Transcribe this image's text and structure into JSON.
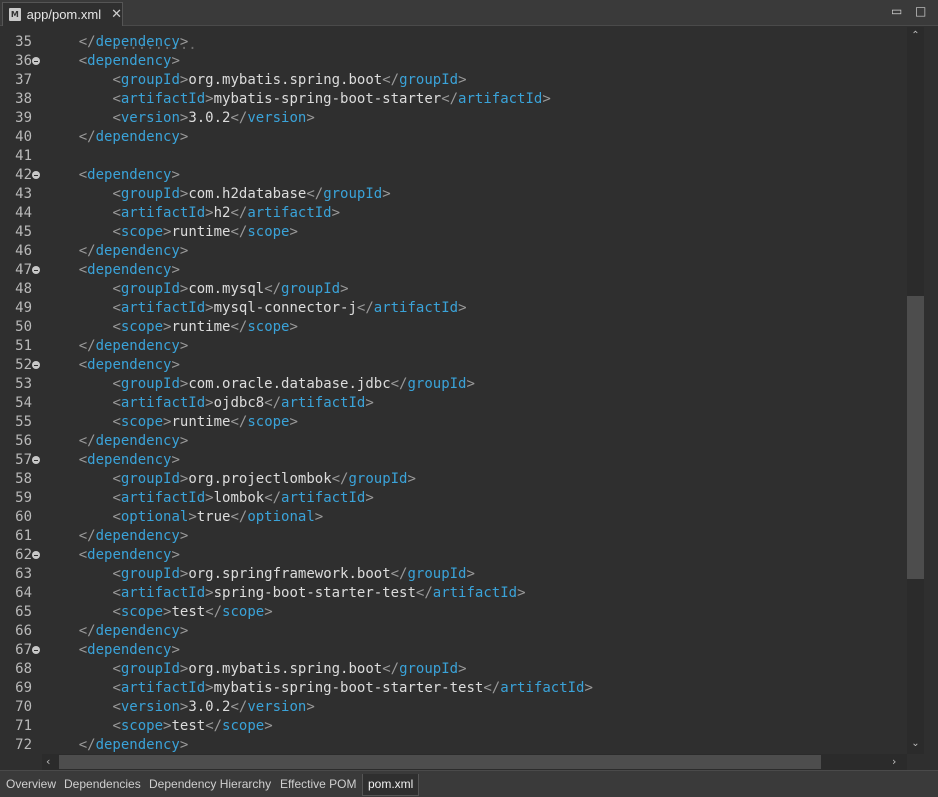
{
  "editor_tab": {
    "title": "app/pom.xml",
    "icon": "xml-file-icon"
  },
  "window_controls": {
    "minimize": "▭",
    "maximize": "□"
  },
  "code_lines": [
    {
      "n": "35",
      "fold": false,
      "indent": 4,
      "parts": [
        [
          "b",
          "</"
        ],
        [
          "t",
          "dependency"
        ],
        [
          "b",
          ">"
        ]
      ]
    },
    {
      "n": "36",
      "fold": true,
      "indent": 4,
      "parts": [
        [
          "b",
          "<"
        ],
        [
          "t",
          "dependency"
        ],
        [
          "b",
          ">"
        ]
      ]
    },
    {
      "n": "37",
      "fold": false,
      "indent": 8,
      "parts": [
        [
          "b",
          "<"
        ],
        [
          "t",
          "groupId"
        ],
        [
          "b",
          ">"
        ],
        [
          "v",
          "org.mybatis.spring.boot"
        ],
        [
          "b",
          "</"
        ],
        [
          "t",
          "groupId"
        ],
        [
          "b",
          ">"
        ]
      ]
    },
    {
      "n": "38",
      "fold": false,
      "indent": 8,
      "parts": [
        [
          "b",
          "<"
        ],
        [
          "t",
          "artifactId"
        ],
        [
          "b",
          ">"
        ],
        [
          "v",
          "mybatis-spring-boot-starter"
        ],
        [
          "b",
          "</"
        ],
        [
          "t",
          "artifactId"
        ],
        [
          "b",
          ">"
        ]
      ]
    },
    {
      "n": "39",
      "fold": false,
      "indent": 8,
      "parts": [
        [
          "b",
          "<"
        ],
        [
          "t",
          "version"
        ],
        [
          "b",
          ">"
        ],
        [
          "v",
          "3.0.2"
        ],
        [
          "b",
          "</"
        ],
        [
          "t",
          "version"
        ],
        [
          "b",
          ">"
        ]
      ]
    },
    {
      "n": "40",
      "fold": false,
      "indent": 4,
      "parts": [
        [
          "b",
          "</"
        ],
        [
          "t",
          "dependency"
        ],
        [
          "b",
          ">"
        ]
      ]
    },
    {
      "n": "41",
      "fold": false,
      "indent": 0,
      "parts": []
    },
    {
      "n": "42",
      "fold": true,
      "indent": 4,
      "parts": [
        [
          "b",
          "<"
        ],
        [
          "t",
          "dependency"
        ],
        [
          "b",
          ">"
        ]
      ]
    },
    {
      "n": "43",
      "fold": false,
      "indent": 8,
      "parts": [
        [
          "b",
          "<"
        ],
        [
          "t",
          "groupId"
        ],
        [
          "b",
          ">"
        ],
        [
          "v",
          "com.h2database"
        ],
        [
          "b",
          "</"
        ],
        [
          "t",
          "groupId"
        ],
        [
          "b",
          ">"
        ]
      ]
    },
    {
      "n": "44",
      "fold": false,
      "indent": 8,
      "parts": [
        [
          "b",
          "<"
        ],
        [
          "t",
          "artifactId"
        ],
        [
          "b",
          ">"
        ],
        [
          "v",
          "h2"
        ],
        [
          "b",
          "</"
        ],
        [
          "t",
          "artifactId"
        ],
        [
          "b",
          ">"
        ]
      ]
    },
    {
      "n": "45",
      "fold": false,
      "indent": 8,
      "parts": [
        [
          "b",
          "<"
        ],
        [
          "t",
          "scope"
        ],
        [
          "b",
          ">"
        ],
        [
          "v",
          "runtime"
        ],
        [
          "b",
          "</"
        ],
        [
          "t",
          "scope"
        ],
        [
          "b",
          ">"
        ]
      ]
    },
    {
      "n": "46",
      "fold": false,
      "indent": 4,
      "parts": [
        [
          "b",
          "</"
        ],
        [
          "t",
          "dependency"
        ],
        [
          "b",
          ">"
        ]
      ]
    },
    {
      "n": "47",
      "fold": true,
      "indent": 4,
      "parts": [
        [
          "b",
          "<"
        ],
        [
          "t",
          "dependency"
        ],
        [
          "b",
          ">"
        ]
      ]
    },
    {
      "n": "48",
      "fold": false,
      "indent": 8,
      "parts": [
        [
          "b",
          "<"
        ],
        [
          "t",
          "groupId"
        ],
        [
          "b",
          ">"
        ],
        [
          "v",
          "com.mysql"
        ],
        [
          "b",
          "</"
        ],
        [
          "t",
          "groupId"
        ],
        [
          "b",
          ">"
        ]
      ]
    },
    {
      "n": "49",
      "fold": false,
      "indent": 8,
      "parts": [
        [
          "b",
          "<"
        ],
        [
          "t",
          "artifactId"
        ],
        [
          "b",
          ">"
        ],
        [
          "v",
          "mysql-connector-j"
        ],
        [
          "b",
          "</"
        ],
        [
          "t",
          "artifactId"
        ],
        [
          "b",
          ">"
        ]
      ]
    },
    {
      "n": "50",
      "fold": false,
      "indent": 8,
      "parts": [
        [
          "b",
          "<"
        ],
        [
          "t",
          "scope"
        ],
        [
          "b",
          ">"
        ],
        [
          "v",
          "runtime"
        ],
        [
          "b",
          "</"
        ],
        [
          "t",
          "scope"
        ],
        [
          "b",
          ">"
        ]
      ]
    },
    {
      "n": "51",
      "fold": false,
      "indent": 4,
      "parts": [
        [
          "b",
          "</"
        ],
        [
          "t",
          "dependency"
        ],
        [
          "b",
          ">"
        ]
      ]
    },
    {
      "n": "52",
      "fold": true,
      "indent": 4,
      "parts": [
        [
          "b",
          "<"
        ],
        [
          "t",
          "dependency"
        ],
        [
          "b",
          ">"
        ]
      ]
    },
    {
      "n": "53",
      "fold": false,
      "indent": 8,
      "parts": [
        [
          "b",
          "<"
        ],
        [
          "t",
          "groupId"
        ],
        [
          "b",
          ">"
        ],
        [
          "v",
          "com.oracle.database.jdbc"
        ],
        [
          "b",
          "</"
        ],
        [
          "t",
          "groupId"
        ],
        [
          "b",
          ">"
        ]
      ]
    },
    {
      "n": "54",
      "fold": false,
      "indent": 8,
      "parts": [
        [
          "b",
          "<"
        ],
        [
          "t",
          "artifactId"
        ],
        [
          "b",
          ">"
        ],
        [
          "v",
          "ojdbc8"
        ],
        [
          "b",
          "</"
        ],
        [
          "t",
          "artifactId"
        ],
        [
          "b",
          ">"
        ]
      ]
    },
    {
      "n": "55",
      "fold": false,
      "indent": 8,
      "parts": [
        [
          "b",
          "<"
        ],
        [
          "t",
          "scope"
        ],
        [
          "b",
          ">"
        ],
        [
          "v",
          "runtime"
        ],
        [
          "b",
          "</"
        ],
        [
          "t",
          "scope"
        ],
        [
          "b",
          ">"
        ]
      ]
    },
    {
      "n": "56",
      "fold": false,
      "indent": 4,
      "parts": [
        [
          "b",
          "</"
        ],
        [
          "t",
          "dependency"
        ],
        [
          "b",
          ">"
        ]
      ]
    },
    {
      "n": "57",
      "fold": true,
      "indent": 4,
      "parts": [
        [
          "b",
          "<"
        ],
        [
          "t",
          "dependency"
        ],
        [
          "b",
          ">"
        ]
      ]
    },
    {
      "n": "58",
      "fold": false,
      "indent": 8,
      "parts": [
        [
          "b",
          "<"
        ],
        [
          "t",
          "groupId"
        ],
        [
          "b",
          ">"
        ],
        [
          "v",
          "org.projectlombok"
        ],
        [
          "b",
          "</"
        ],
        [
          "t",
          "groupId"
        ],
        [
          "b",
          ">"
        ]
      ]
    },
    {
      "n": "59",
      "fold": false,
      "indent": 8,
      "parts": [
        [
          "b",
          "<"
        ],
        [
          "t",
          "artifactId"
        ],
        [
          "b",
          ">"
        ],
        [
          "v",
          "lombok"
        ],
        [
          "b",
          "</"
        ],
        [
          "t",
          "artifactId"
        ],
        [
          "b",
          ">"
        ]
      ]
    },
    {
      "n": "60",
      "fold": false,
      "indent": 8,
      "parts": [
        [
          "b",
          "<"
        ],
        [
          "t",
          "optional"
        ],
        [
          "b",
          ">"
        ],
        [
          "v",
          "true"
        ],
        [
          "b",
          "</"
        ],
        [
          "t",
          "optional"
        ],
        [
          "b",
          ">"
        ]
      ]
    },
    {
      "n": "61",
      "fold": false,
      "indent": 4,
      "parts": [
        [
          "b",
          "</"
        ],
        [
          "t",
          "dependency"
        ],
        [
          "b",
          ">"
        ]
      ]
    },
    {
      "n": "62",
      "fold": true,
      "indent": 4,
      "parts": [
        [
          "b",
          "<"
        ],
        [
          "t",
          "dependency"
        ],
        [
          "b",
          ">"
        ]
      ]
    },
    {
      "n": "63",
      "fold": false,
      "indent": 8,
      "parts": [
        [
          "b",
          "<"
        ],
        [
          "t",
          "groupId"
        ],
        [
          "b",
          ">"
        ],
        [
          "v",
          "org.springframework.boot"
        ],
        [
          "b",
          "</"
        ],
        [
          "t",
          "groupId"
        ],
        [
          "b",
          ">"
        ]
      ]
    },
    {
      "n": "64",
      "fold": false,
      "indent": 8,
      "parts": [
        [
          "b",
          "<"
        ],
        [
          "t",
          "artifactId"
        ],
        [
          "b",
          ">"
        ],
        [
          "v",
          "spring-boot-starter-test"
        ],
        [
          "b",
          "</"
        ],
        [
          "t",
          "artifactId"
        ],
        [
          "b",
          ">"
        ]
      ]
    },
    {
      "n": "65",
      "fold": false,
      "indent": 8,
      "parts": [
        [
          "b",
          "<"
        ],
        [
          "t",
          "scope"
        ],
        [
          "b",
          ">"
        ],
        [
          "v",
          "test"
        ],
        [
          "b",
          "</"
        ],
        [
          "t",
          "scope"
        ],
        [
          "b",
          ">"
        ]
      ]
    },
    {
      "n": "66",
      "fold": false,
      "indent": 4,
      "parts": [
        [
          "b",
          "</"
        ],
        [
          "t",
          "dependency"
        ],
        [
          "b",
          ">"
        ]
      ]
    },
    {
      "n": "67",
      "fold": true,
      "indent": 4,
      "parts": [
        [
          "b",
          "<"
        ],
        [
          "t",
          "dependency"
        ],
        [
          "b",
          ">"
        ]
      ]
    },
    {
      "n": "68",
      "fold": false,
      "indent": 8,
      "parts": [
        [
          "b",
          "<"
        ],
        [
          "t",
          "groupId"
        ],
        [
          "b",
          ">"
        ],
        [
          "v",
          "org.mybatis.spring.boot"
        ],
        [
          "b",
          "</"
        ],
        [
          "t",
          "groupId"
        ],
        [
          "b",
          ">"
        ]
      ]
    },
    {
      "n": "69",
      "fold": false,
      "indent": 8,
      "parts": [
        [
          "b",
          "<"
        ],
        [
          "t",
          "artifactId"
        ],
        [
          "b",
          ">"
        ],
        [
          "v",
          "mybatis-spring-boot-starter-test"
        ],
        [
          "b",
          "</"
        ],
        [
          "t",
          "artifactId"
        ],
        [
          "b",
          ">"
        ]
      ]
    },
    {
      "n": "70",
      "fold": false,
      "indent": 8,
      "parts": [
        [
          "b",
          "<"
        ],
        [
          "t",
          "version"
        ],
        [
          "b",
          ">"
        ],
        [
          "v",
          "3.0.2"
        ],
        [
          "b",
          "</"
        ],
        [
          "t",
          "version"
        ],
        [
          "b",
          ">"
        ]
      ]
    },
    {
      "n": "71",
      "fold": false,
      "indent": 8,
      "parts": [
        [
          "b",
          "<"
        ],
        [
          "t",
          "scope"
        ],
        [
          "b",
          ">"
        ],
        [
          "v",
          "test"
        ],
        [
          "b",
          "</"
        ],
        [
          "t",
          "scope"
        ],
        [
          "b",
          ">"
        ]
      ]
    },
    {
      "n": "72",
      "fold": false,
      "indent": 4,
      "parts": [
        [
          "b",
          "</"
        ],
        [
          "t",
          "dependency"
        ],
        [
          "b",
          ">"
        ]
      ]
    }
  ],
  "page_tabs": [
    {
      "label": "Overview",
      "active": false
    },
    {
      "label": "Dependencies",
      "active": false
    },
    {
      "label": "Dependency Hierarchy",
      "active": false
    },
    {
      "label": "Effective POM",
      "active": false
    },
    {
      "label": "pom.xml",
      "active": true
    }
  ],
  "colors": {
    "tag": "#3aa3d9",
    "bracket": "#9a9a9a",
    "text": "#dcdcdc",
    "background": "#2f2f2f"
  }
}
